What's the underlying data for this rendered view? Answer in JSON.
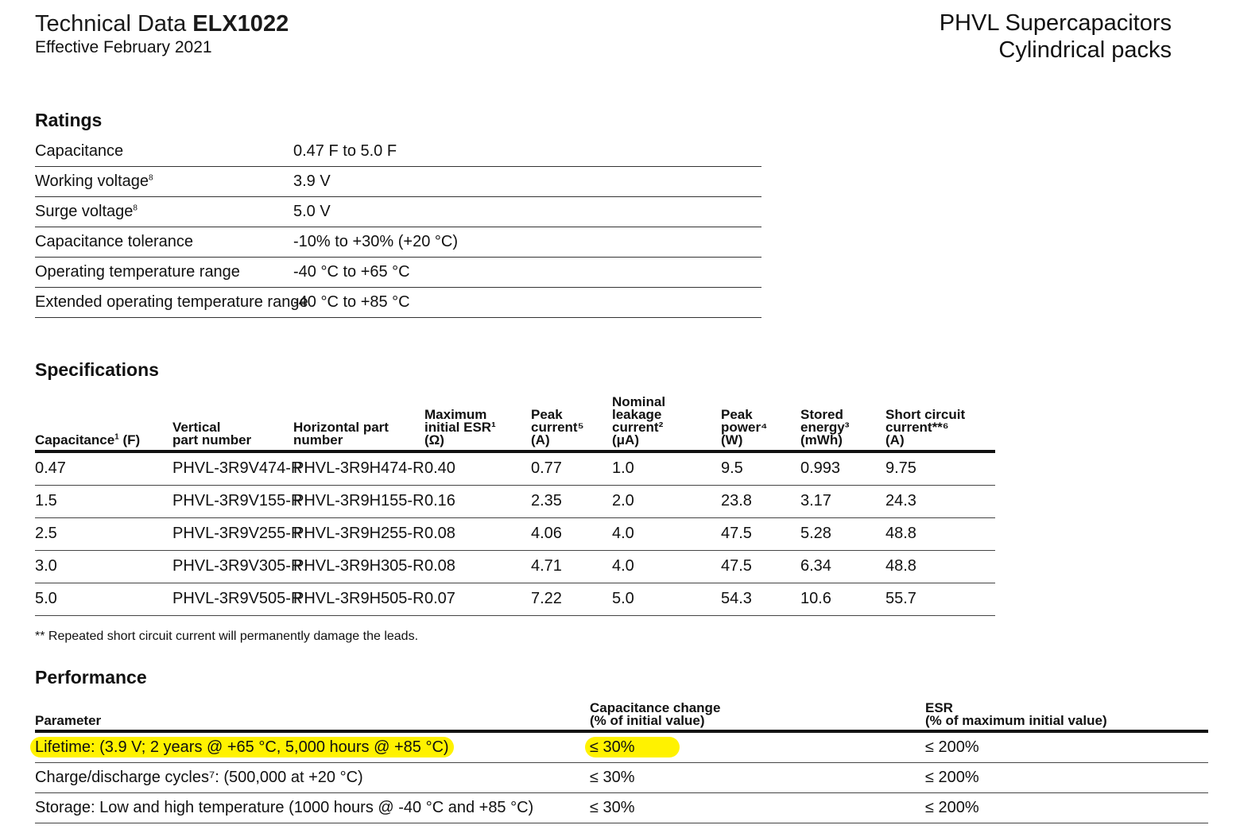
{
  "header": {
    "title_prefix": "Technical Data",
    "title_code": "ELX1022",
    "effective": "Effective February 2021",
    "product_line_1": "PHVL Supercapacitors",
    "product_line_2": "Cylindrical packs"
  },
  "ratings": {
    "heading": "Ratings",
    "rows": [
      {
        "label": "Capacitance",
        "sup": "",
        "value": "0.47 F to 5.0 F"
      },
      {
        "label": "Working voltage",
        "sup": "8",
        "value": "3.9 V"
      },
      {
        "label": "Surge voltage",
        "sup": "8",
        "value": "5.0 V"
      },
      {
        "label": "Capacitance tolerance",
        "sup": "",
        "value": "-10% to +30% (+20 °C)"
      },
      {
        "label": "Operating temperature range",
        "sup": "",
        "value": "-40 °C to +65 °C"
      },
      {
        "label": "Extended operating temperature range",
        "sup": "",
        "value": "-40 °C to +85 °C"
      }
    ]
  },
  "specifications": {
    "heading": "Specifications",
    "columns": [
      {
        "l1": "",
        "l2": "",
        "l3": "Capacitance",
        "sup": "1",
        "l3b": " (F)"
      },
      {
        "l1": "",
        "l2": "Vertical",
        "l3": "part number"
      },
      {
        "l1": "",
        "l2": "Horizontal part",
        "l3": "number"
      },
      {
        "l1": "Maximum",
        "l2": "initial ESR¹",
        "l3": "(Ω)"
      },
      {
        "l1": "Peak",
        "l2": "current⁵",
        "l3": "(A)"
      },
      {
        "l0": "Nominal",
        "l1": "leakage",
        "l2": "current²",
        "l3": "(μA)"
      },
      {
        "l1": "Peak",
        "l2": "power⁴",
        "l3": "(W)"
      },
      {
        "l1": "Stored",
        "l2": "energy³",
        "l3": "(mWh)"
      },
      {
        "l1": "Short circuit",
        "l2": "current**⁶",
        "l3": "(A)"
      }
    ],
    "rows": [
      [
        "0.47",
        "PHVL-3R9V474-R",
        "PHVL-3R9H474-R",
        "0.40",
        "0.77",
        "1.0",
        "9.5",
        "0.993",
        "9.75"
      ],
      [
        "1.5",
        "PHVL-3R9V155-R",
        "PHVL-3R9H155-R",
        "0.16",
        "2.35",
        "2.0",
        "23.8",
        "3.17",
        "24.3"
      ],
      [
        "2.5",
        "PHVL-3R9V255-R",
        "PHVL-3R9H255-R",
        "0.08",
        "4.06",
        "4.0",
        "47.5",
        "5.28",
        "48.8"
      ],
      [
        "3.0",
        "PHVL-3R9V305-R",
        "PHVL-3R9H305-R",
        "0.08",
        "4.71",
        "4.0",
        "47.5",
        "6.34",
        "48.8"
      ],
      [
        "5.0",
        "PHVL-3R9V505-R",
        "PHVL-3R9H505-R",
        "0.07",
        "7.22",
        "5.0",
        "54.3",
        "10.6",
        "55.7"
      ]
    ],
    "note": "** Repeated short circuit current will permanently damage the leads."
  },
  "performance": {
    "heading": "Performance",
    "col_parameter": "Parameter",
    "col_cap_1": "Capacitance change",
    "col_cap_2": "(% of initial value)",
    "col_esr_1": "ESR",
    "col_esr_2": "(% of maximum initial value)",
    "rows": [
      {
        "param": "Lifetime: (3.9 V; 2 years @ +65 °C, 5,000 hours @ +85 °C)",
        "cap": "≤ 30%",
        "esr": "≤ 200%",
        "highlighted": true
      },
      {
        "param": "Charge/discharge cycles⁷: (500,000 at +20 °C)",
        "cap": "≤ 30%",
        "esr": "≤ 200%",
        "highlighted": false
      },
      {
        "param": "Storage: Low and high temperature (1000 hours @ -40 °C and +85 °C)",
        "cap": "≤ 30%",
        "esr": "≤ 200%",
        "highlighted": false
      }
    ],
    "highlight_color": "#fff200"
  }
}
